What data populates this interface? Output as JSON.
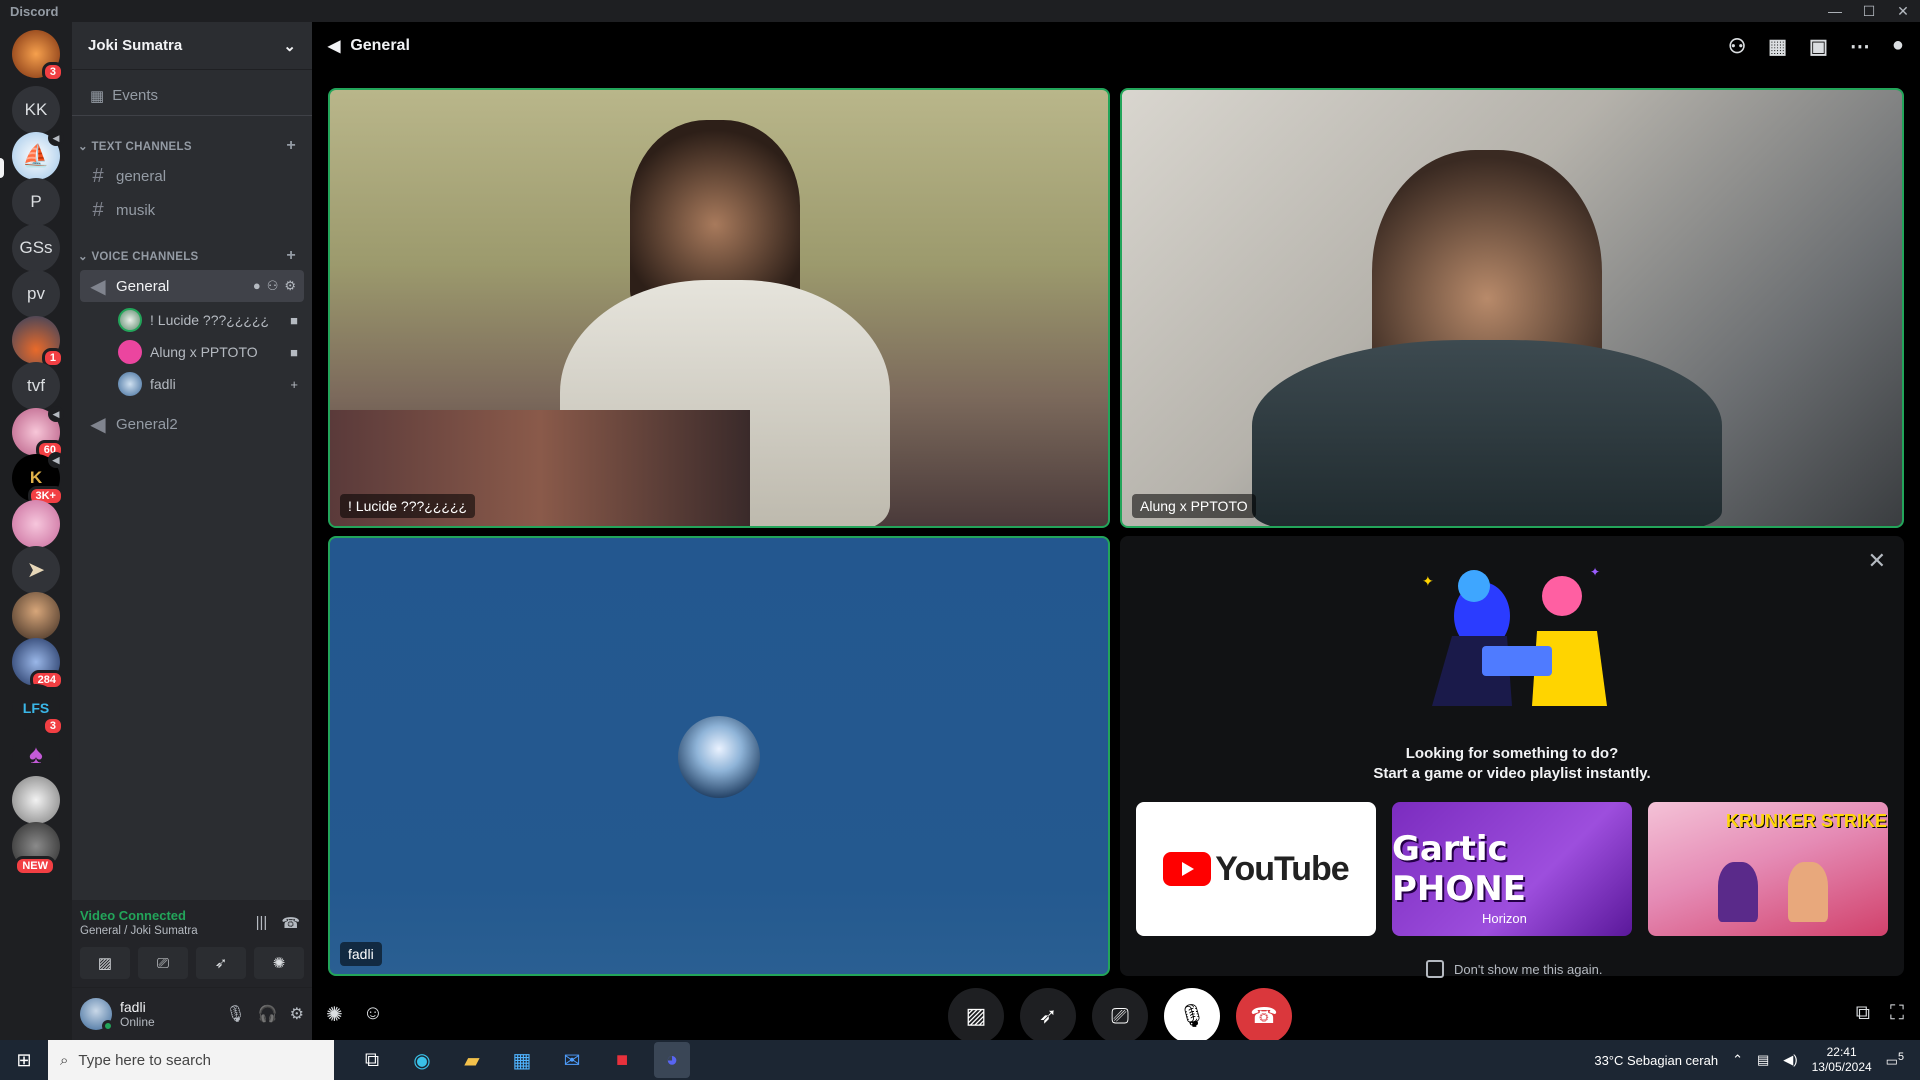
{
  "app": {
    "title": "Discord"
  },
  "window_controls": {
    "minimize": "—",
    "maximize": "☐",
    "close": "✕"
  },
  "servers": [
    {
      "label": "",
      "badge": "3"
    },
    {
      "label": "KK",
      "badge": ""
    },
    {
      "label": "",
      "badge": ""
    },
    {
      "label": "P",
      "badge": ""
    },
    {
      "label": "GSs",
      "badge": ""
    },
    {
      "label": "pv",
      "badge": ""
    },
    {
      "label": "",
      "badge": "1"
    },
    {
      "label": "tvf",
      "badge": ""
    },
    {
      "label": "",
      "badge": "60"
    },
    {
      "label": "",
      "badge": "3K+"
    },
    {
      "label": "",
      "badge": ""
    },
    {
      "label": "",
      "badge": ""
    },
    {
      "label": "",
      "badge": ""
    },
    {
      "label": "",
      "badge": "284"
    },
    {
      "label": "",
      "badge": "3"
    },
    {
      "label": "",
      "badge": ""
    },
    {
      "label": "",
      "badge": ""
    },
    {
      "label": "",
      "badge": "NEW"
    }
  ],
  "guild": {
    "name": "Joki Sumatra",
    "events_label": "Events",
    "text_category": "TEXT CHANNELS",
    "text_channels": [
      "general",
      "musik"
    ],
    "voice_category": "VOICE CHANNELS",
    "voice_channel_active": "General",
    "voice_users": [
      "! Lucide ???¿¿¿¿¿",
      "Alung x PPTOTO",
      "fadli"
    ],
    "voice_channel_other": "General2"
  },
  "voice_panel": {
    "status": "Video Connected",
    "location": "General / Joki Sumatra"
  },
  "user": {
    "name": "fadli",
    "status": "Online"
  },
  "stage": {
    "channel": "General",
    "tiles": [
      {
        "name": "! Lucide ???¿¿¿¿¿"
      },
      {
        "name": "Alung x PPTOTO"
      },
      {
        "name": "fadli"
      }
    ],
    "activity": {
      "line1": "Looking for something to do?",
      "line2": "Start a game or video playlist instantly.",
      "games": [
        "YouTube",
        "Gartic PHONE",
        "KRUNKER STRIKE"
      ],
      "gartic_brand": "Horizon",
      "dont_show": "Don't show me this again."
    }
  },
  "taskbar": {
    "search_placeholder": "Type here to search",
    "weather": "33°C  Sebagian cerah",
    "time": "22:41",
    "date": "13/05/2024",
    "notif_count": "5"
  },
  "colors": {
    "accent_green": "#23a55a",
    "danger": "#da373c",
    "badge": "#f23f43"
  }
}
